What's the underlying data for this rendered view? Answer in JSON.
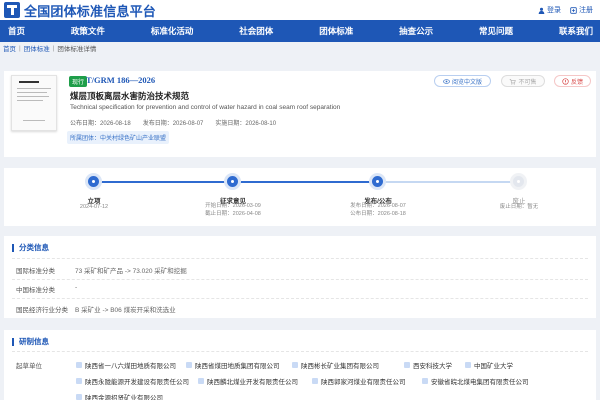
{
  "header": {
    "site_title": "全国团体标准信息平台",
    "links": [
      {
        "icon": "user-icon",
        "label": "登录"
      },
      {
        "icon": "register-icon",
        "label": "注册"
      }
    ]
  },
  "nav": {
    "items": [
      "首页",
      "政策文件",
      "标准化活动",
      "社会团体",
      "团体标准",
      "抽查公示",
      "常见问题",
      "联系我们"
    ]
  },
  "breadcrumb": [
    "首页",
    "团体标准",
    "团体标准详情"
  ],
  "standard": {
    "status_badge": "现行",
    "code": "T/GRM 186—2026",
    "title": "煤层顶板离层水害防治技术规范",
    "title_en": "Technical specification for prevention and control of water hazard in coal seam roof separation",
    "publish_date": "公布日期：2026-08-18",
    "release_date": "发布日期：2026-08-07",
    "implement_date": "实施日期：2026-08-10",
    "org": "所属团体：中关村绿色矿山产业联盟",
    "buttons": {
      "read": "阅览中文版",
      "buy": "不可售",
      "feedback": "反馈"
    }
  },
  "timeline": {
    "steps": [
      {
        "name": "立项",
        "dates": [
          "2024-07-12"
        ],
        "done": true
      },
      {
        "name": "征求意见",
        "dates": [
          "开始日期：2026-03-09",
          "截止日期：2026-04-08"
        ],
        "done": true
      },
      {
        "name": "发布/公布",
        "dates": [
          "发布日期：2026-08-07",
          "公布日期：2026-08-18"
        ],
        "done": true
      },
      {
        "name": "废止",
        "dates": [
          "废止日期：暂无"
        ],
        "done": false
      }
    ],
    "progress": 0.67
  },
  "classification": {
    "heading": "分类信息",
    "rows": [
      {
        "key": "国际标准分类",
        "value": "73 采矿和矿产品 -> 73.020 采矿和挖掘"
      },
      {
        "key": "中国标准分类",
        "value": "-"
      },
      {
        "key": "国民经济行业分类",
        "value": "B 采矿业 -> B06 煤炭开采和洗选业"
      }
    ]
  },
  "drafting": {
    "heading": "研制信息",
    "units_label": "起草单位",
    "units": [
      "陕西省一八六煤田地质有限公司",
      "陕西省煤田地质集团有限公司",
      "陕西彬长矿业集团有限公司",
      "西安科技大学",
      "中国矿业大学",
      "陕西永陇能源开发建设有限责任公司",
      "陕西麟北煤业开发有限责任公司",
      "陕西郭家河煤业有限责任公司",
      "安徽省皖北煤电集团有限责任公司",
      "陕西金源招贤矿业有限公司"
    ]
  }
}
